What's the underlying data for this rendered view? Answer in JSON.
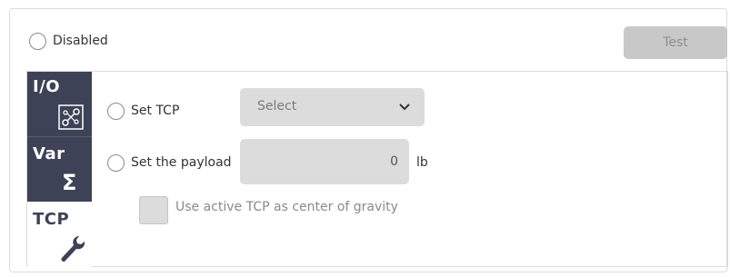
{
  "mode": {
    "disabled_label": "Disabled",
    "test_button_label": "Test"
  },
  "tabs": [
    {
      "label": "I/O",
      "icon": "io-circuit-icon"
    },
    {
      "label": "Var",
      "icon": "sigma-icon",
      "symbol": "Σ"
    },
    {
      "label": "TCP",
      "icon": "wrench-icon"
    }
  ],
  "tcp": {
    "set_tcp_label": "Set TCP",
    "select_value": "Select",
    "set_payload_label": "Set the payload",
    "payload_value": "0",
    "payload_unit": "lb",
    "center_of_gravity_label": "Use active TCP as center of gravity"
  },
  "colors": {
    "tab_active_bg": "#3e4257",
    "field_bg": "#dcdcdc",
    "button_disabled_bg": "#c8c8c8"
  }
}
